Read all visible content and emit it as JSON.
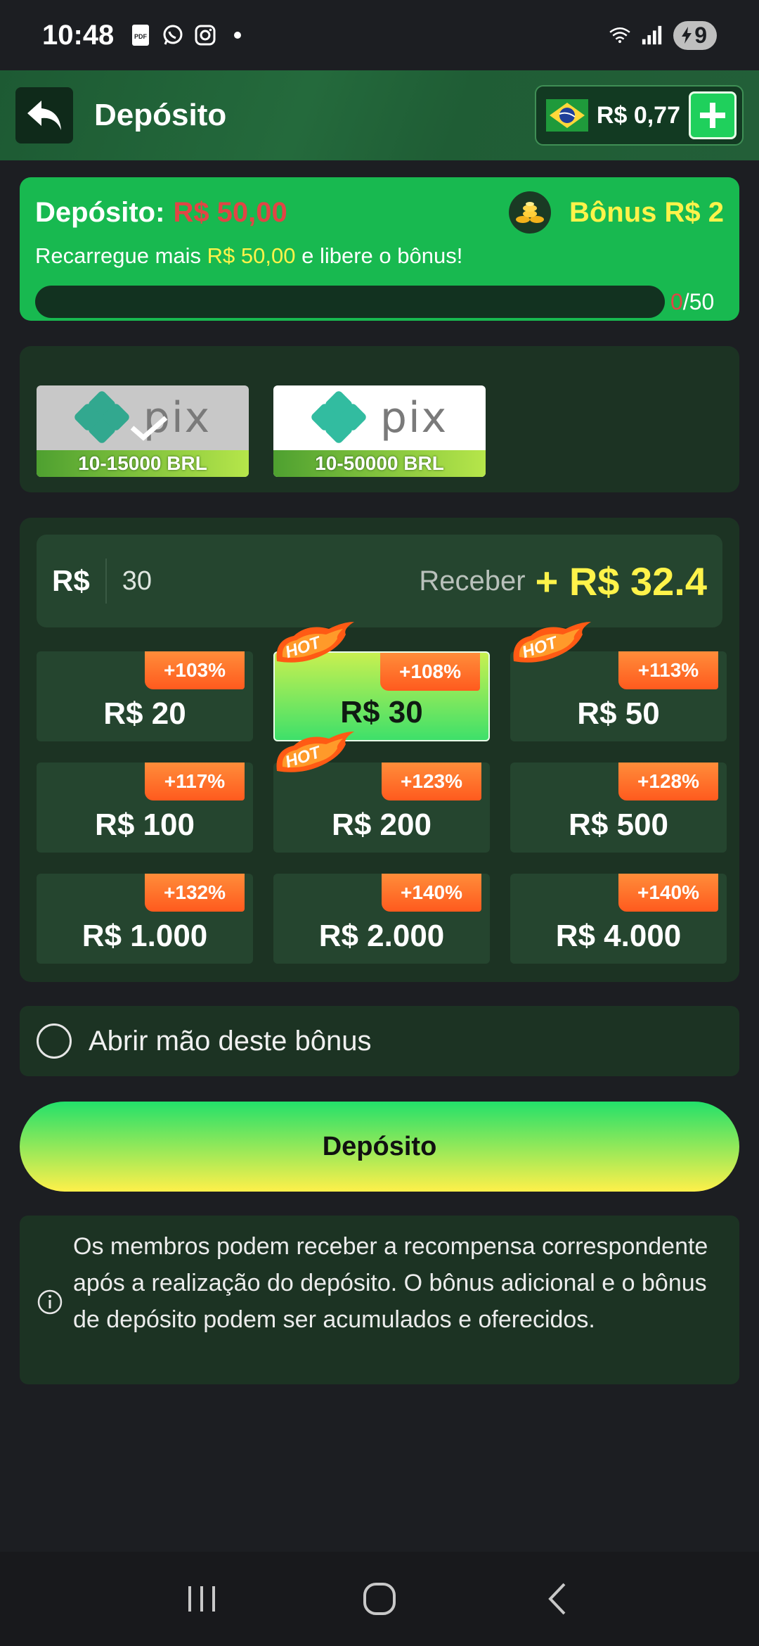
{
  "status": {
    "time": "10:48",
    "battery": "9"
  },
  "header": {
    "title": "Depósito",
    "balance": "R$ 0,77"
  },
  "bonus": {
    "deposit_label": "Depósito:",
    "deposit_amount": "R$ 50,00",
    "bonus_label": "Bônus R$ 2",
    "message_prefix": "Recarregue mais",
    "message_amount": "R$ 50,00",
    "message_suffix": "e libere o bônus!",
    "progress_current": "0",
    "progress_total": "/50",
    "progress_fraction": 0
  },
  "payment_methods": [
    {
      "name": "pix",
      "range": "10-15000 BRL",
      "selected": true
    },
    {
      "name": "pix",
      "range": "10-50000 BRL",
      "selected": false
    }
  ],
  "amount": {
    "currency": "R$",
    "value": "30",
    "receive_label": "Receber",
    "receive_value": "+ R$ 32.4"
  },
  "options": [
    {
      "value": "R$ 20",
      "bonus": "+103%",
      "hot": false,
      "selected": false
    },
    {
      "value": "R$ 30",
      "bonus": "+108%",
      "hot": true,
      "selected": true
    },
    {
      "value": "R$ 50",
      "bonus": "+113%",
      "hot": true,
      "selected": false
    },
    {
      "value": "R$ 100",
      "bonus": "+117%",
      "hot": false,
      "selected": false
    },
    {
      "value": "R$ 200",
      "bonus": "+123%",
      "hot": true,
      "selected": false
    },
    {
      "value": "R$ 500",
      "bonus": "+128%",
      "hot": false,
      "selected": false
    },
    {
      "value": "R$ 1.000",
      "bonus": "+132%",
      "hot": false,
      "selected": false
    },
    {
      "value": "R$ 2.000",
      "bonus": "+140%",
      "hot": false,
      "selected": false
    },
    {
      "value": "R$ 4.000",
      "bonus": "+140%",
      "hot": false,
      "selected": false
    }
  ],
  "hot_label": "HOT",
  "waive": {
    "label": "Abrir mão deste bônus"
  },
  "deposit_button": "Depósito",
  "info": {
    "text": "Os membros podem receber a recompensa correspondente após a realização do depósito. O bônus adicional e o bônus de depósito podem ser acumulados e oferecidos."
  },
  "colors": {
    "accent_green": "#18b950",
    "highlight_yellow": "#fff34a",
    "alert_red": "#e14545",
    "badge_orange": "#ff6a28"
  }
}
